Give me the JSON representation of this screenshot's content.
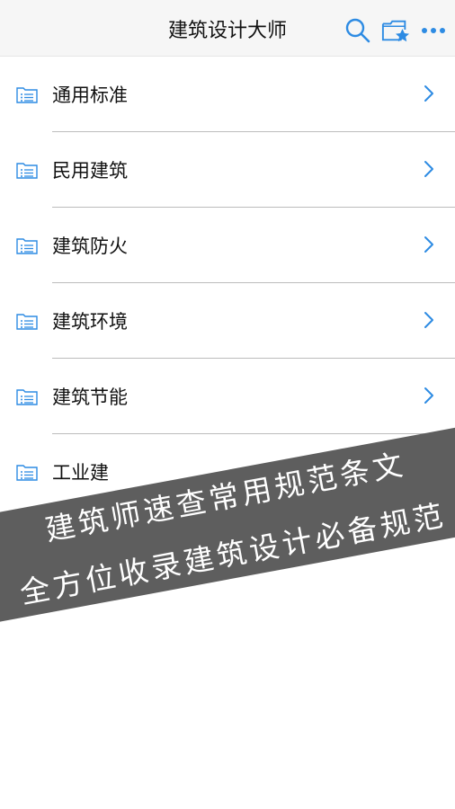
{
  "header": {
    "title": "建筑设计大师",
    "icons": [
      "search-icon",
      "folder-star-icon",
      "more-icon"
    ]
  },
  "list": {
    "items": [
      {
        "label": "通用标准",
        "icon": "list-folder-icon"
      },
      {
        "label": "民用建筑",
        "icon": "list-folder-icon"
      },
      {
        "label": "建筑防火",
        "icon": "list-folder-icon"
      },
      {
        "label": "建筑环境",
        "icon": "list-folder-icon"
      },
      {
        "label": "建筑节能",
        "icon": "list-folder-icon"
      },
      {
        "label": "工业建",
        "icon": "list-folder-icon"
      }
    ]
  },
  "banner": {
    "line1": "建筑师速查常用规范条文",
    "line2": "全方位收录建筑设计必备规范"
  },
  "colors": {
    "accent": "#2d8be3",
    "banner": "#5e5e5e",
    "divider": "#bcbcbc",
    "navbar": "#f6f6f6"
  }
}
